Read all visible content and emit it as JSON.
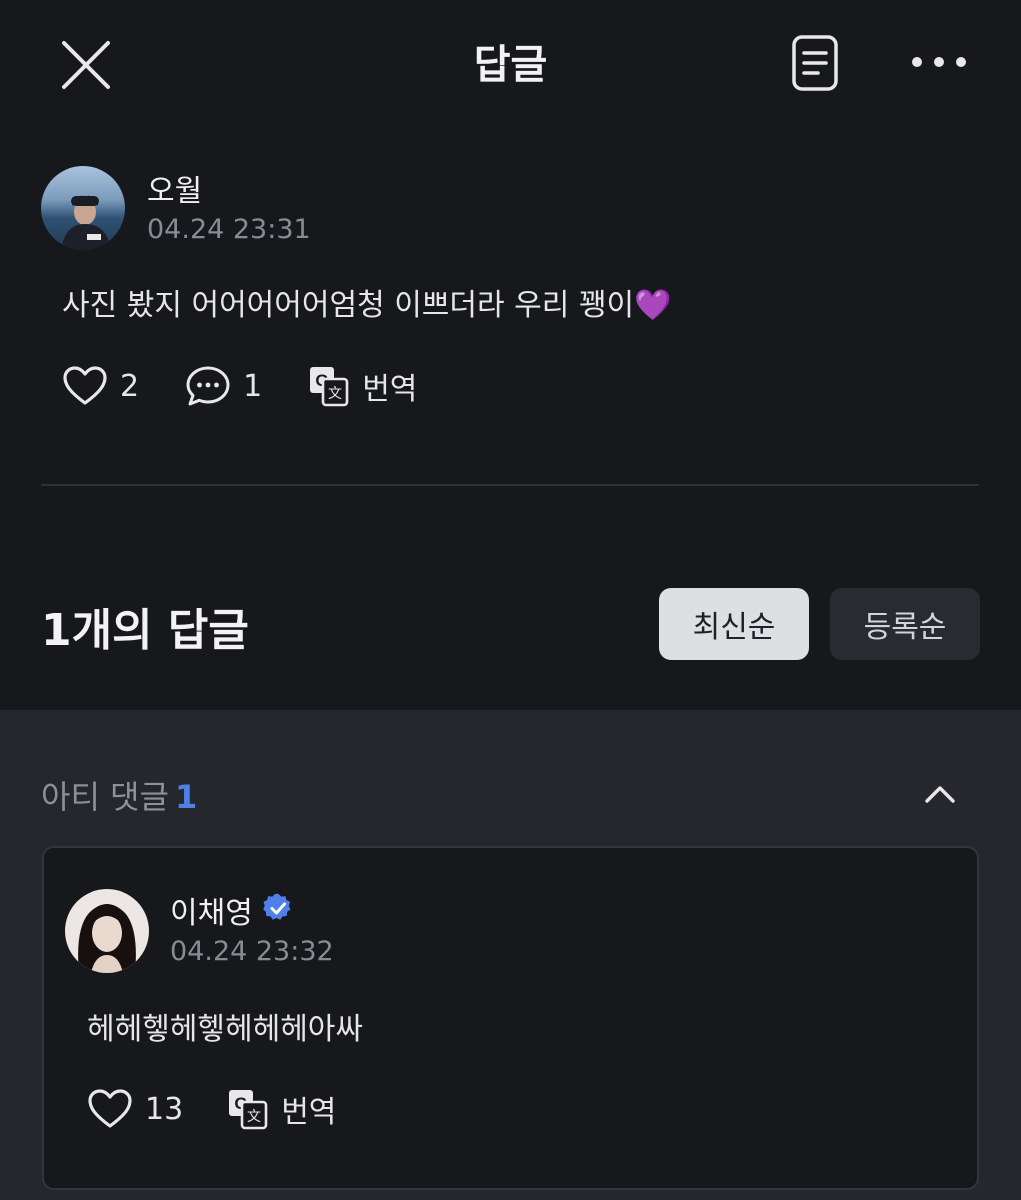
{
  "header": {
    "title": "답글",
    "close_icon": "close-icon",
    "doc_icon": "document-icon",
    "more_icon": "more-horizontal-icon"
  },
  "post": {
    "author": "오월",
    "timestamp": "04.24 23:31",
    "text": "사진 봤지 어어어어어엄청 이쁘더라 우리 꽹이💜",
    "likes": "2",
    "comments": "1",
    "translate_label": "번역"
  },
  "replies": {
    "count_label": "1개의 답글",
    "sort_latest": "최신순",
    "sort_oldest": "등록순"
  },
  "artist_section": {
    "label": "아티 댓글",
    "count": "1",
    "accent_color": "#4f7fe8",
    "comment": {
      "author": "이채영",
      "timestamp": "04.24 23:32",
      "text": "헤헤헿헤헿헤헤헤아싸",
      "likes": "13",
      "translate_label": "번역"
    }
  }
}
